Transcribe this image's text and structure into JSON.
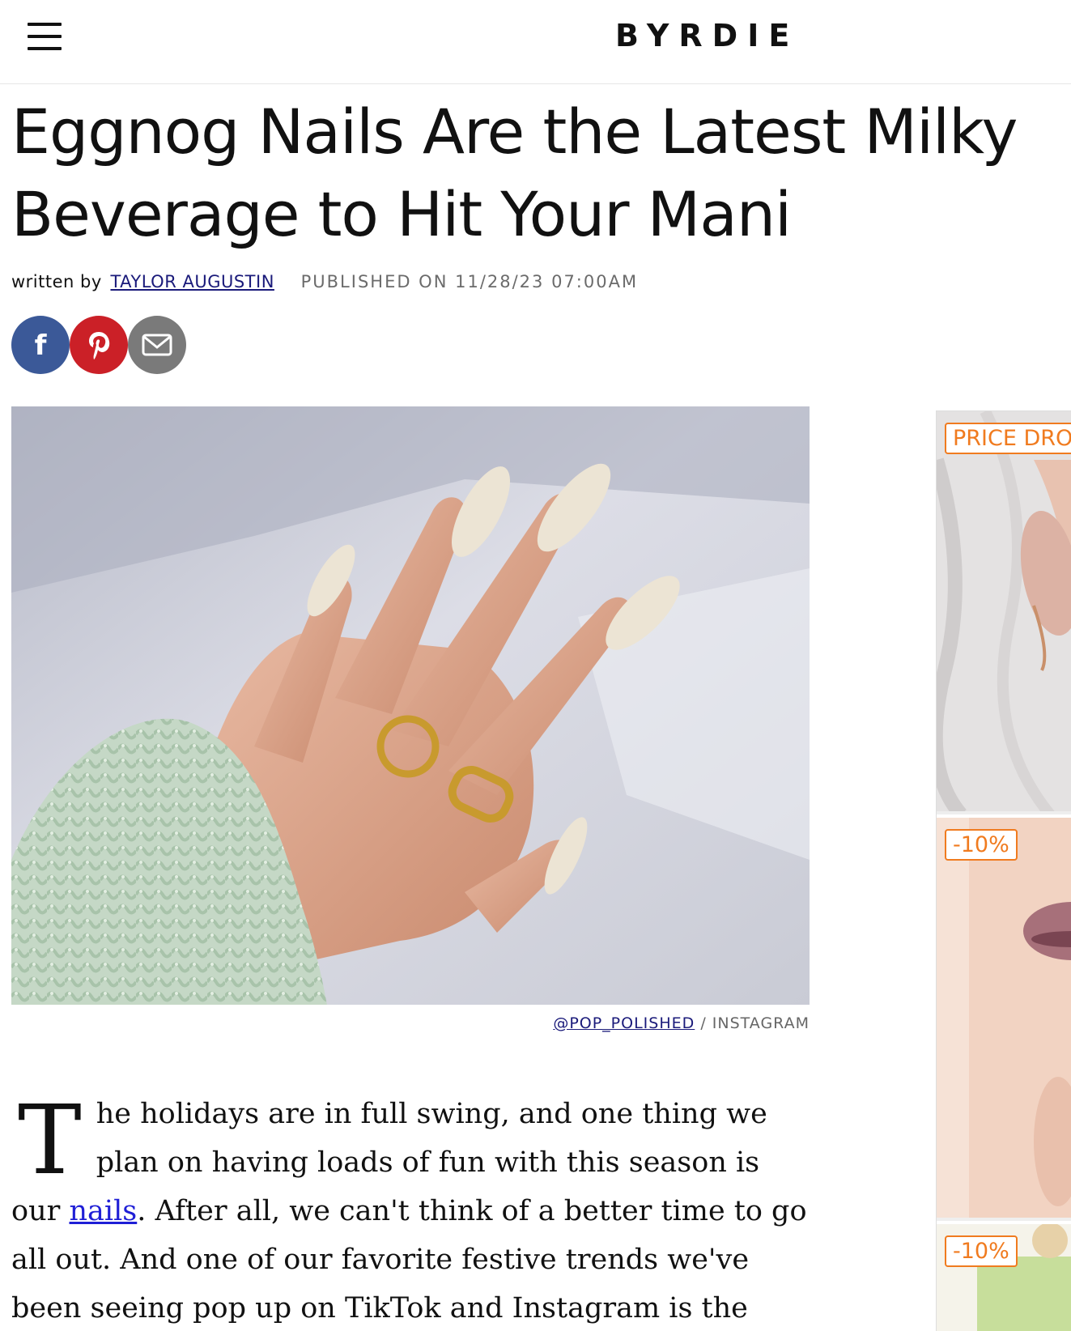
{
  "header": {
    "menu_icon": "hamburger-menu-icon",
    "logo": "BYRDIE"
  },
  "article": {
    "title_line1": "Eggnog Nails Are the Latest Milky",
    "title_line2": "Beverage to Hit Your Mani",
    "byline_prefix": "written by",
    "author": "TAYLOR AUGUSTIN",
    "published": "PUBLISHED ON 11/28/23 07:00AM"
  },
  "share": {
    "facebook_icon": "facebook-icon",
    "pinterest_icon": "pinterest-icon",
    "email_icon": "email-icon"
  },
  "image": {
    "credit_handle": "@POP_POLISHED",
    "credit_source": "/ INSTAGRAM"
  },
  "body": {
    "dropcap": "T",
    "text_before_link": "he holidays are in full swing, and one thing we plan on having loads of fun with this season is our ",
    "link_text": "nails",
    "text_after_link": ". After all, we can't think of a better time to go all out. And one of our favorite festive trends we've been seeing pop up on TikTok and Instagram is the eggnog nails. It's the perfect creamy,"
  },
  "sidebar_ad": {
    "tiles": [
      {
        "badge": "PRICE DRO"
      },
      {
        "badge": "-10%"
      },
      {
        "badge": "-10%"
      }
    ],
    "accent_color": "#f07b1f"
  }
}
